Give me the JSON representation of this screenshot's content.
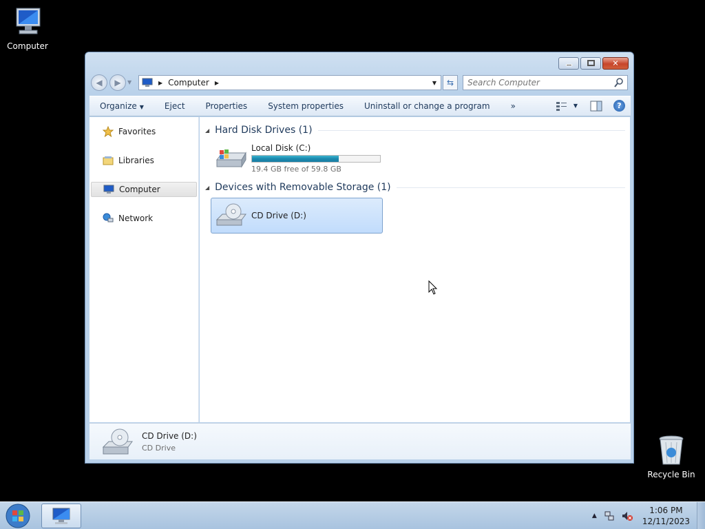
{
  "desktop": {
    "icons": [
      {
        "label": "Computer",
        "icon": "computer-icon"
      },
      {
        "label": "Recycle Bin",
        "icon": "recycle-bin-icon"
      }
    ]
  },
  "window": {
    "caption_buttons": [
      "minimize",
      "maximize",
      "close"
    ],
    "address": {
      "crumbs": [
        "Computer"
      ]
    },
    "search": {
      "placeholder": "Search Computer"
    },
    "toolbar": {
      "organize": "Organize",
      "eject": "Eject",
      "properties": "Properties",
      "system_properties": "System properties",
      "uninstall": "Uninstall or change a program",
      "more": "»"
    },
    "nav_pane": {
      "items": [
        {
          "label": "Favorites",
          "icon": "star-icon"
        },
        {
          "label": "Libraries",
          "icon": "libraries-icon"
        },
        {
          "label": "Computer",
          "icon": "computer-icon",
          "selected": true
        },
        {
          "label": "Network",
          "icon": "network-icon"
        }
      ]
    },
    "content": {
      "groups": [
        {
          "title": "Hard Disk Drives (1)",
          "items": [
            {
              "name": "Local Disk (C:)",
              "free_text": "19.4 GB free of 59.8 GB",
              "used_fraction": 0.676
            }
          ]
        },
        {
          "title": "Devices with Removable Storage (1)",
          "items": [
            {
              "name": "CD Drive (D:)",
              "selected": true
            }
          ]
        }
      ]
    },
    "details": {
      "title": "CD Drive (D:)",
      "subtitle": "CD Drive"
    }
  },
  "taskbar": {
    "clock": {
      "time": "1:06 PM",
      "date": "12/11/2023"
    }
  },
  "colors": {
    "accent": "#1b89ad",
    "selection": "#c1dcfc"
  }
}
